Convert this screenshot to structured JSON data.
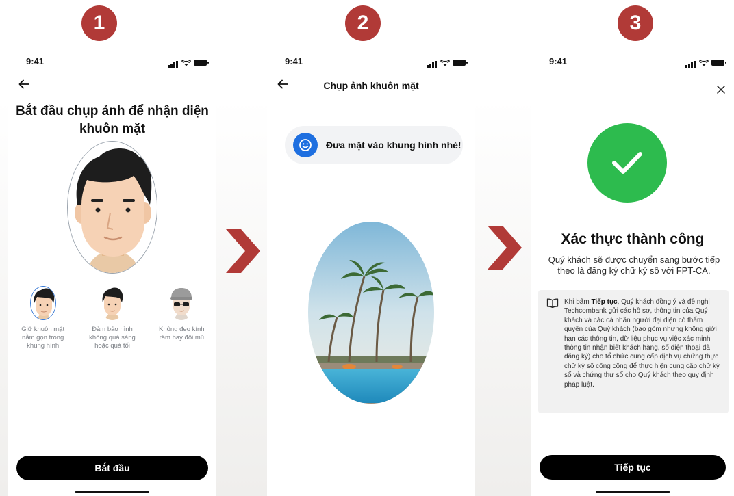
{
  "steps": [
    "1",
    "2",
    "3"
  ],
  "status_time": "9:41",
  "screen1": {
    "title_line1": "Bắt đầu chụp ảnh để nhận diện",
    "title_line2": "khuôn mặt",
    "tips": [
      {
        "label": "Giữ khuôn mặt nằm gọn trong khung hình"
      },
      {
        "label": "Đảm bảo hình không quá sáng hoặc quá tối"
      },
      {
        "label": "Không đeo kính râm hay đội mũ"
      }
    ],
    "start_label": "Bắt đầu"
  },
  "screen2": {
    "title": "Chụp ảnh khuôn mặt",
    "hint": "Đưa mặt vào khung hình nhé!"
  },
  "screen3": {
    "title": "Xác thực thành công",
    "subtitle": "Quý khách sẽ được chuyển sang bước tiếp theo là đăng ký chữ ký số với FPT-CA.",
    "consent_prefix": "Khi bấm ",
    "consent_bold": "Tiếp tục",
    "consent_body": ", Quý khách đồng ý và đề nghị Techcombank gửi các hồ sơ, thông tin của Quý khách và các cá nhân người đại diện có thẩm quyền của Quý khách (bao gồm nhưng không giới hạn các thông tin, dữ liệu phục vụ việc xác minh thông tin nhận biết khách hàng, số điện thoại đã đăng ký) cho tổ chức cung cấp dịch vụ chứng thực chữ ký số công cộng để thực hiện cung cấp chữ ký số và chứng thư số cho Quý khách theo quy định pháp luật.",
    "continue_label": "Tiếp tục"
  },
  "colors": {
    "badge": "#b13a37",
    "success": "#2dbb4e",
    "hint_icon": "#1e6fe0",
    "button": "#000000"
  },
  "icons": [
    "back-arrow-icon",
    "close-icon",
    "checkmark-icon",
    "face-scan-icon",
    "book-icon",
    "signal-icon",
    "wifi-icon",
    "battery-icon",
    "chevron-right-icon"
  ]
}
